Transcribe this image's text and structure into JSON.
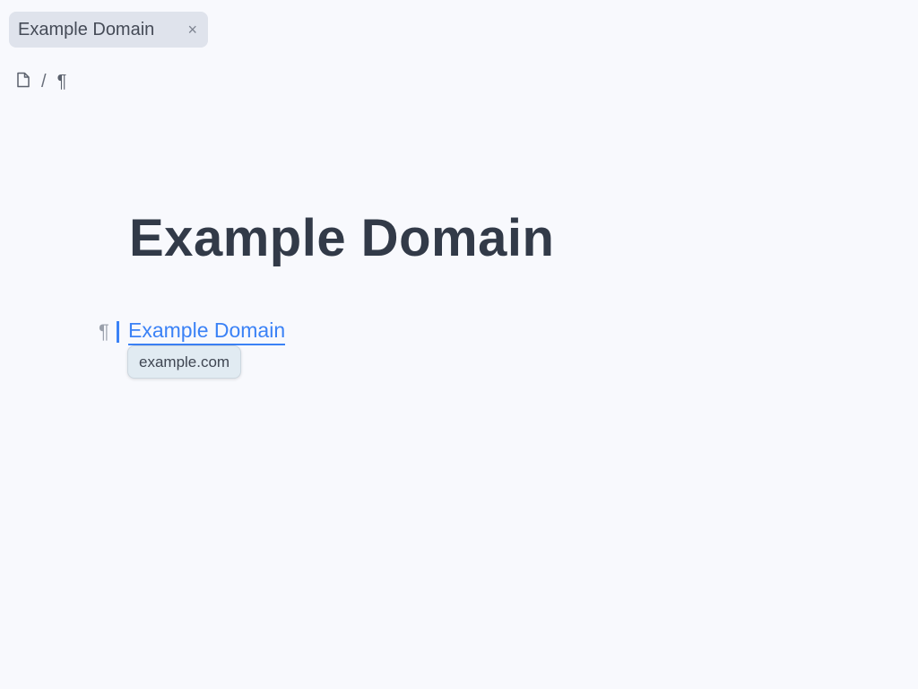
{
  "tab": {
    "title": "Example Domain",
    "close_glyph": "×"
  },
  "breadcrumb": {
    "items": [
      {
        "icon": "document-icon"
      },
      {
        "separator": "/"
      },
      {
        "icon": "pilcrow-icon",
        "glyph": "¶"
      }
    ]
  },
  "document": {
    "heading": "Example Domain",
    "paragraph_mark": "¶",
    "link_text": "Example Domain",
    "link_tooltip": "example.com"
  },
  "colors": {
    "background": "#f8f9fd",
    "tab_background": "#dfe3ec",
    "heading": "#323a48",
    "link": "#3b82f6",
    "tooltip_background": "#e1ebf2"
  }
}
